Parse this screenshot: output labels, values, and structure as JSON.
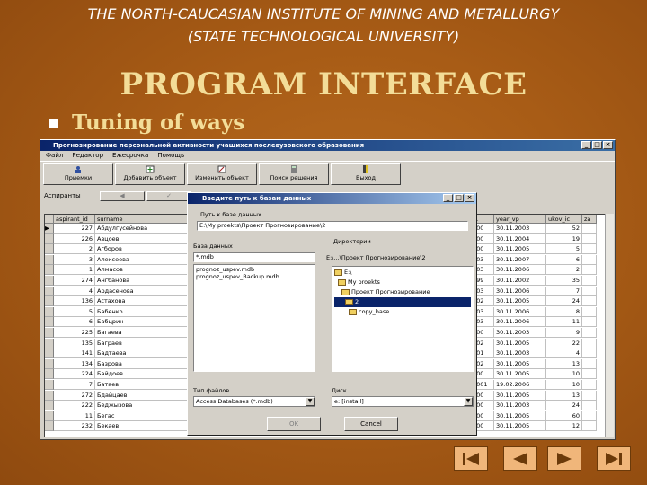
{
  "header": {
    "line1": "THE NORTH-CAUCASIAN INSTITUTE OF MINING AND METALLURGY",
    "line2": "(STATE TECHNOLOGICAL UNIVERSITY)",
    "title": "PROGRAM INTERFACE",
    "subtitle": "Tuning of ways"
  },
  "app": {
    "title": "Прогнозирование персональной активности учащихся послевузовского образования",
    "menu": [
      "Файл",
      "Редактор",
      "Ежесрочка",
      "Помощь"
    ],
    "toolbar": [
      "Приемки",
      "Добавить объект",
      "Изменить объект",
      "Поиск решения",
      "Выход"
    ],
    "tab_label": "Аспиранты",
    "tab_buttons": [
      "◀",
      "✓"
    ],
    "columns": [
      "aspirant_id",
      "surname",
      "...",
      "...",
      "year_vp",
      "ukov_ic",
      "za"
    ],
    "rows": [
      {
        "id": "227",
        "name": "Абдулгусейнова",
        "k": "000",
        "d": "30.11.2003",
        "v": "52"
      },
      {
        "id": "226",
        "name": "Авцоев",
        "k": "000",
        "d": "30.11.2004",
        "v": "19"
      },
      {
        "id": "2",
        "name": "Агборов",
        "k": "000",
        "d": "30.11.2005",
        "v": "5"
      },
      {
        "id": "3",
        "name": "Алексеева",
        "k": "003",
        "d": "30.11.2007",
        "v": "6"
      },
      {
        "id": "1",
        "name": "Алмасов",
        "k": "003",
        "d": "30.11.2006",
        "v": "2"
      },
      {
        "id": "274",
        "name": "Ангбанова",
        "k": "099",
        "d": "30.11.2002",
        "v": "35"
      },
      {
        "id": "4",
        "name": "Ардасенова",
        "k": "003",
        "d": "30.11.2006",
        "v": "7"
      },
      {
        "id": "136",
        "name": "Астахова",
        "k": "002",
        "d": "30.11.2005",
        "v": "24"
      },
      {
        "id": "5",
        "name": "Бабенко",
        "k": "003",
        "d": "30.11.2006",
        "v": "8"
      },
      {
        "id": "6",
        "name": "Бабцрин",
        "k": "003",
        "d": "30.11.2006",
        "v": "11"
      },
      {
        "id": "225",
        "name": "Багаева",
        "k": "000",
        "d": "30.11.2003",
        "v": "9"
      },
      {
        "id": "135",
        "name": "Баграев",
        "k": "002",
        "d": "30.11.2005",
        "v": "22"
      },
      {
        "id": "141",
        "name": "Бадтаева",
        "k": "001",
        "d": "30.11.2003",
        "v": "4"
      },
      {
        "id": "134",
        "name": "Базрова",
        "k": "002",
        "d": "30.11.2005",
        "v": "13"
      },
      {
        "id": "224",
        "name": "Байдоев",
        "k": "000",
        "d": "30.11.2005",
        "v": "10"
      },
      {
        "id": "7",
        "name": "Батаев",
        "k": "2001",
        "d": "19.02.2006",
        "v": "10"
      },
      {
        "id": "272",
        "name": "Бдайцаев",
        "k": "000",
        "d": "30.11.2005",
        "v": "13"
      },
      {
        "id": "222",
        "name": "Беджызова",
        "k": "000",
        "d": "30.11.2003",
        "v": "24"
      },
      {
        "id": "11",
        "name": "Бегас",
        "k": "000",
        "d": "30.11.2005",
        "v": "60"
      },
      {
        "id": "232",
        "name": "Бекаев",
        "k": "000",
        "d": "30.11.2005",
        "v": "12"
      }
    ]
  },
  "dialog": {
    "title": "Введите путь к базам данных",
    "path_label": "Путь к базе данных",
    "path_value": "E:\\My proekts\\Проект Прогнозирование\\2",
    "db_label": "База данных",
    "db_filter": "*.mdb",
    "files": [
      "prognoz_uspev.mdb",
      "prognoz_uspev_Backup.mdb"
    ],
    "dir_label": "Директории",
    "dir_path": "E:\\...\\Проект Прогнозирование\\2",
    "dirs": [
      "E:\\",
      "My proekts",
      "Проект Прогнозирование",
      "2",
      "copy_base"
    ],
    "filetype_label": "Тип файлов",
    "filetype_value": "Access Databases (*.mdb)",
    "drive_label": "Диск",
    "drive_value": "e: [install]",
    "ok_label": "OK",
    "cancel_label": "Cancel"
  },
  "nav": [
    "first",
    "previous",
    "next",
    "last"
  ]
}
